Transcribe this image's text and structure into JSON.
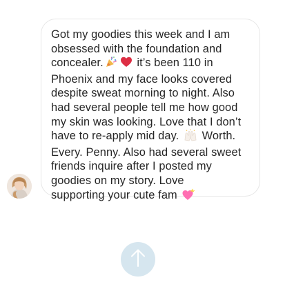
{
  "message": {
    "lines": [
      "Got my goodies this week and I am",
      "obsessed with the foundation and",
      "concealer.",
      "it’s been 110 in",
      "Phoenix and my face looks covered",
      "despite sweat morning to night. Also",
      "had several people tell me how good",
      "my skin was looking. Love that I don’t",
      "have to re-apply mid day.",
      "Worth.",
      "Every. Penny. Also had several sweet",
      "friends inquire after I posted my",
      "goodies on my story. Love",
      "supporting your cute fam"
    ],
    "emojis": [
      "party-popper-icon",
      "red-heart-icon",
      "raising-hands-icon",
      "heart-with-ribbon-icon"
    ]
  },
  "colors": {
    "text": "#262626",
    "bubble_border": "#e6e6e6",
    "scroll_button": "#d6e6ef"
  },
  "icons": {
    "scroll_button": "arrow-up-icon",
    "avatar": "avatar"
  }
}
